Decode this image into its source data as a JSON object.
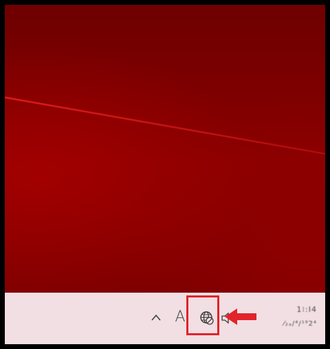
{
  "desktop": {
    "wallpaper_color": "#7b0000",
    "accent_streak_color": "#ff2828"
  },
  "taskbar": {
    "background": "#f1dfe3",
    "tray": {
      "show_hidden_icons": {
        "glyph": "^",
        "icon": "chevron-up-icon"
      },
      "input_indicator": {
        "label": "A",
        "icon": "ime-indicator"
      },
      "network": {
        "icon": "globe-no-internet-icon"
      },
      "volume": {
        "icon": "speaker-muted-icon"
      }
    },
    "clock": {
      "time": "1⁝:Ⅰ4",
      "date": "⁄₂ₐ/⁴/¹⁹2⁴"
    }
  },
  "annotation": {
    "highlight_color": "#e2232a",
    "arrow_color": "#e2232a"
  }
}
